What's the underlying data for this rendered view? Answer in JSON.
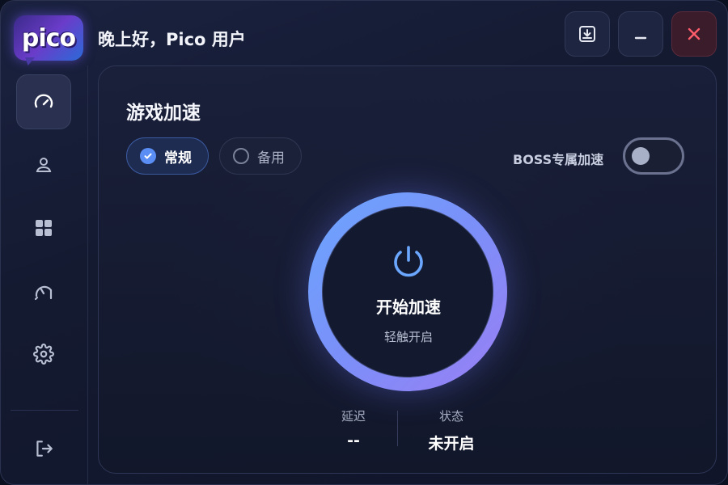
{
  "app": {
    "logo_text": "pico",
    "greeting": "晚上好，Pico 用户"
  },
  "titlebar": {
    "buttons": [
      {
        "name": "download",
        "icon": "download-icon"
      },
      {
        "name": "minimize",
        "icon": "minimize-icon"
      },
      {
        "name": "close",
        "icon": "close-icon"
      }
    ]
  },
  "sidebar": {
    "items": [
      {
        "icon": "speedometer-icon",
        "active": true
      },
      {
        "icon": "user-icon",
        "active": false
      },
      {
        "icon": "apps-grid-icon",
        "active": false
      },
      {
        "icon": "speed-test-icon",
        "active": false
      },
      {
        "icon": "gear-icon",
        "active": false
      }
    ],
    "footer": {
      "icon": "logout-icon"
    }
  },
  "main": {
    "title": "游戏加速",
    "modes": [
      {
        "label": "常规",
        "selected": true
      },
      {
        "label": "备用",
        "selected": false
      }
    ],
    "boss": {
      "label": "BOSS专属加速",
      "enabled": false
    },
    "power": {
      "title": "开始加速",
      "subtitle": "轻触开启"
    },
    "stats": {
      "latency": {
        "label": "延迟",
        "value": "--"
      },
      "status": {
        "label": "状态",
        "value": "未开启"
      }
    }
  },
  "colors": {
    "accent": "#5b8ef5",
    "ring_start": "#6ba6ff",
    "ring_end": "#9a7ef5",
    "close": "#ff5d6c"
  }
}
